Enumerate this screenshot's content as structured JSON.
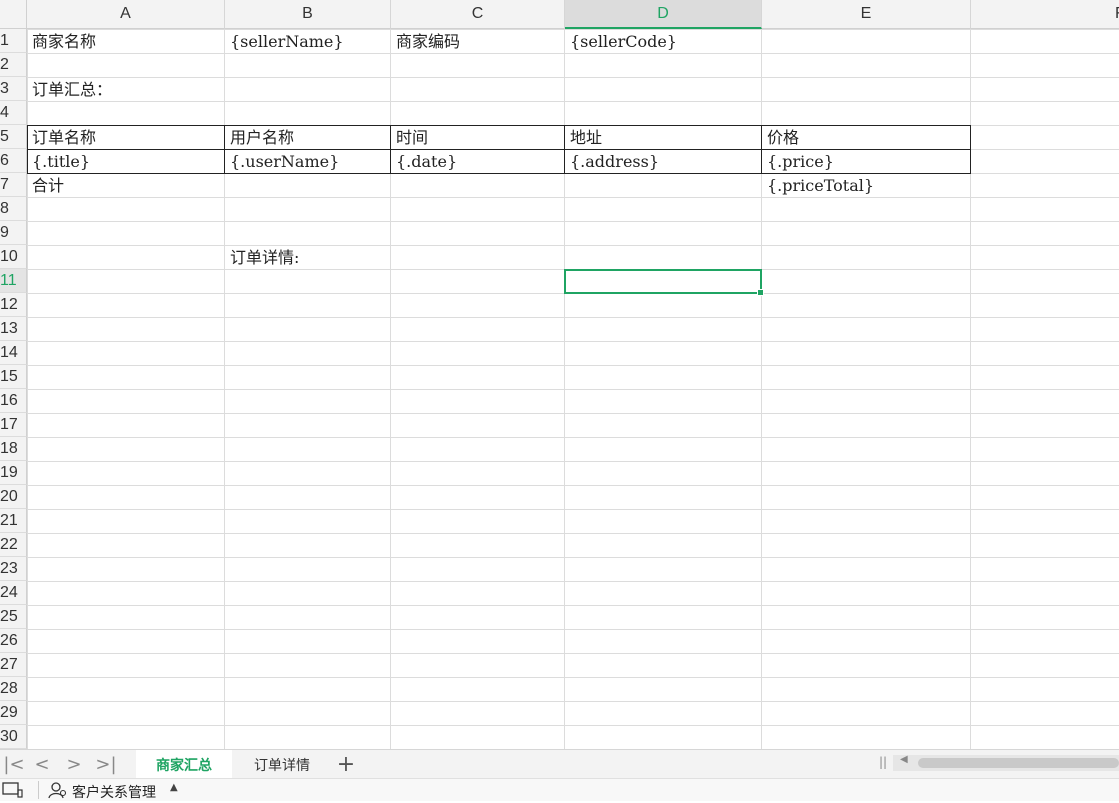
{
  "columns": [
    "A",
    "B",
    "C",
    "D",
    "E",
    "F"
  ],
  "active_column": "D",
  "rows": [
    "1",
    "2",
    "3",
    "4",
    "5",
    "6",
    "7",
    "8",
    "9",
    "10",
    "11",
    "12",
    "13",
    "14",
    "15",
    "16",
    "17",
    "18",
    "19",
    "20",
    "21",
    "22",
    "23",
    "24",
    "25",
    "26",
    "27",
    "28",
    "29",
    "30"
  ],
  "active_row": "11",
  "cells": {
    "A1": "商家名称",
    "B1": "{sellerName}",
    "C1": "商家编码",
    "D1": "{sellerCode}",
    "A3": "订单汇总：",
    "A5": "订单名称",
    "B5": "用户名称",
    "C5": "时间",
    "D5": "地址",
    "E5": "价格",
    "A6": "{.title}",
    "B6": "{.userName}",
    "C6": "{.date}",
    "D6": "{.address}",
    "E6": "{.price}",
    "A7": "合计",
    "E7": "{.priceTotal}",
    "B10": "订单详情:"
  },
  "sheet_tabs": [
    {
      "label": "商家汇总",
      "active": true
    },
    {
      "label": "订单详情",
      "active": false
    }
  ],
  "nav": {
    "first": "|<",
    "prev": "<",
    "next": ">",
    "last": ">|",
    "add_tab": "+"
  },
  "status_bar": {
    "label": "客户关系管理",
    "caret": "▲"
  },
  "accent_color": "#1fa463"
}
